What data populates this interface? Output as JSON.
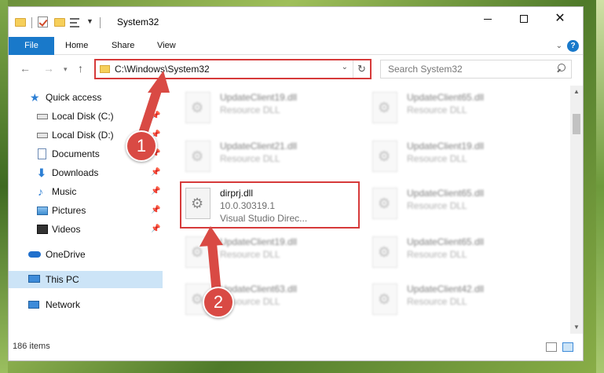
{
  "window": {
    "title": "System32"
  },
  "ribbon": {
    "tabs": [
      "File",
      "Home",
      "Share",
      "View"
    ],
    "help": "?"
  },
  "address": {
    "path": "C:\\Windows\\System32",
    "search_placeholder": "Search System32"
  },
  "nav_pane": {
    "items": [
      {
        "label": "Quick access",
        "icon": "star-icon"
      },
      {
        "label": "Local Disk (C:)",
        "icon": "drive-icon"
      },
      {
        "label": "Local Disk (D:)",
        "icon": "drive-icon"
      },
      {
        "label": "Documents",
        "icon": "documents-icon"
      },
      {
        "label": "Downloads",
        "icon": "downloads-icon"
      },
      {
        "label": "Music",
        "icon": "music-icon"
      },
      {
        "label": "Pictures",
        "icon": "pictures-icon"
      },
      {
        "label": "Videos",
        "icon": "videos-icon"
      },
      {
        "label": "OneDrive",
        "icon": "onedrive-icon"
      },
      {
        "label": "This PC",
        "icon": "pc-icon",
        "selected": true
      },
      {
        "label": "Network",
        "icon": "network-icon"
      }
    ]
  },
  "files": {
    "left": [
      {
        "name": "UpdateClient19.dll",
        "desc": "Resource DLL"
      },
      {
        "name": "UpdateClient21.dll",
        "desc": "Resource DLL"
      },
      {
        "name": "dirprj.dll",
        "version": "10.0.30319.1",
        "desc": "Visual Studio Direc...",
        "highlight": true
      },
      {
        "name": "UpdateClient19.dll",
        "desc": "Resource DLL"
      },
      {
        "name": "UpdateClient63.dll",
        "desc": "Resource DLL"
      }
    ],
    "right": [
      {
        "name": "UpdateClient65.dll",
        "desc": "Resource DLL"
      },
      {
        "name": "UpdateClient19.dll",
        "desc": "Resource DLL"
      },
      {
        "name": "UpdateClient65.dll",
        "desc": "Resource DLL"
      },
      {
        "name": "UpdateClient65.dll",
        "desc": "Resource DLL"
      },
      {
        "name": "UpdateClient42.dll",
        "desc": "Resource DLL"
      }
    ]
  },
  "status": {
    "item_count": "186 items"
  },
  "annotations": {
    "badge_1": "1",
    "badge_2": "2",
    "color": "#d94a44"
  }
}
